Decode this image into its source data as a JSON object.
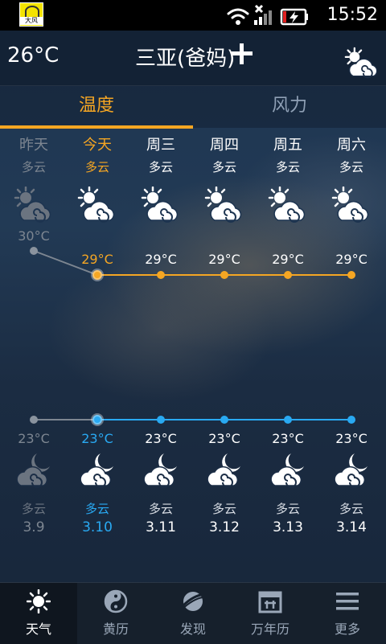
{
  "status_bar": {
    "app_badge_label": "大风",
    "time": "15:52"
  },
  "header": {
    "current_temp": "26°C",
    "city": "三亚(爸妈)",
    "weather_icon": "cloudy-sun-icon"
  },
  "tabs": [
    {
      "label": "温度",
      "active": true
    },
    {
      "label": "风力",
      "active": false
    }
  ],
  "days": [
    {
      "name": "昨天",
      "cond_day": "多云",
      "high": "30°C",
      "low": "23°C",
      "cond_night": "多云",
      "date": "3.9",
      "past": true
    },
    {
      "name": "今天",
      "cond_day": "多云",
      "high": "29°C",
      "low": "23°C",
      "cond_night": "多云",
      "date": "3.10",
      "today": true
    },
    {
      "name": "周三",
      "cond_day": "多云",
      "high": "29°C",
      "low": "23°C",
      "cond_night": "多云",
      "date": "3.11"
    },
    {
      "name": "周四",
      "cond_day": "多云",
      "high": "29°C",
      "low": "23°C",
      "cond_night": "多云",
      "date": "3.12"
    },
    {
      "name": "周五",
      "cond_day": "多云",
      "high": "29°C",
      "low": "23°C",
      "cond_night": "多云",
      "date": "3.13"
    },
    {
      "name": "周六",
      "cond_day": "多云",
      "high": "29°C",
      "low": "23°C",
      "cond_night": "多云",
      "date": "3.14"
    }
  ],
  "chart_data": [
    {
      "type": "line",
      "categories": [
        "昨天",
        "今天",
        "周三",
        "周四",
        "周五",
        "周六"
      ],
      "series": [
        {
          "values": [
            30,
            29,
            29,
            29,
            29,
            29
          ]
        }
      ]
    },
    {
      "type": "line",
      "categories": [
        "昨天",
        "今天",
        "周三",
        "周四",
        "周五",
        "周六"
      ],
      "series": [
        {
          "values": [
            23,
            23,
            23,
            23,
            23,
            23
          ]
        }
      ]
    }
  ],
  "bottom_nav": [
    {
      "label": "天气",
      "icon": "sun-icon",
      "active": true
    },
    {
      "label": "黄历",
      "icon": "yin-yang-icon",
      "active": false
    },
    {
      "label": "发现",
      "icon": "planet-icon",
      "active": false
    },
    {
      "label": "万年历",
      "icon": "calendar-icon",
      "active": false
    },
    {
      "label": "更多",
      "icon": "menu-icon",
      "active": false
    }
  ],
  "colors": {
    "accent": "#f5a623",
    "today_blue": "#29a9f2",
    "past_gray": "#7d8691"
  }
}
